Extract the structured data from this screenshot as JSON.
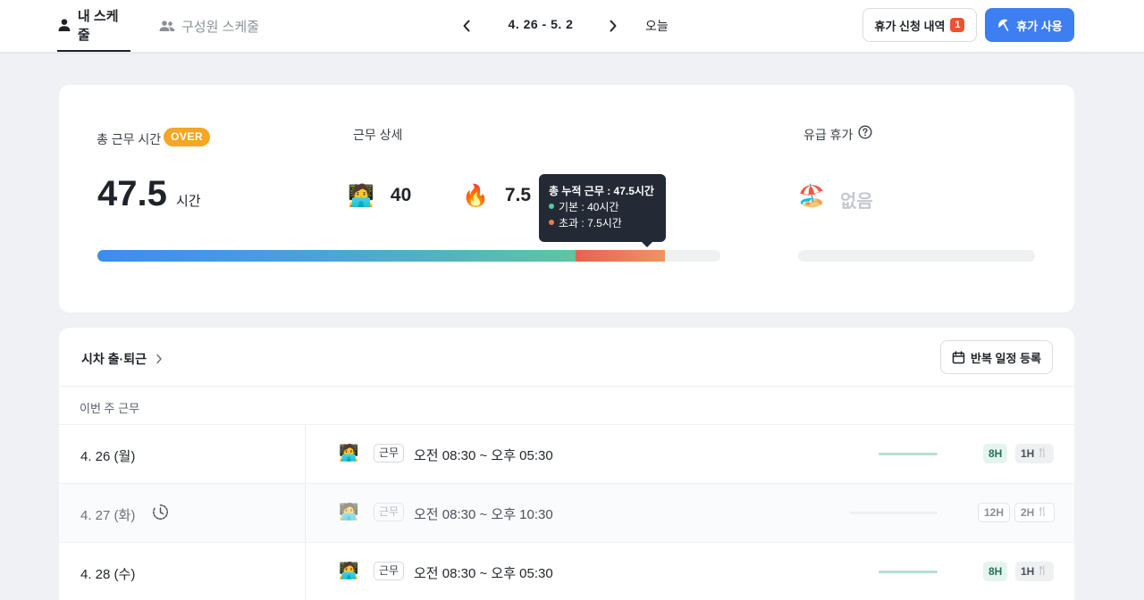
{
  "header": {
    "tab_my": "내 스케줄",
    "tab_members": "구성원 스케줄",
    "date_range": "4. 26 - 5. 2",
    "today": "오늘",
    "history_label": "휴가 신청 내역",
    "history_count": "1",
    "leave_use_label": "휴가 사용",
    "accent_color": "#3d7ff0"
  },
  "summary": {
    "total_label": "총 근무 시간",
    "over_badge": "OVER",
    "total_value": "47.5",
    "total_unit": "시간",
    "detail_label": "근무 상세",
    "base_emoji": "🧑‍💻",
    "base_value": "40",
    "over_emoji": "🔥",
    "over_value": "7.5",
    "tooltip": {
      "title": "총 누적 근무 : 47.5시간",
      "base": "기본 : 40시간",
      "over": "초과 : 7.5시간",
      "base_color": "#5cc6a0",
      "over_color": "#ee7a4f"
    },
    "progress": {
      "base_fraction": 0.768,
      "over_fraction": 0.144
    },
    "paid_leave_label": "유급 휴가",
    "paid_leave_emoji": "🏖️",
    "paid_leave_value": "없음"
  },
  "schedule": {
    "flex_link": "시차 출·퇴근",
    "repeat_button": "반복 일정 등록",
    "week_label": "이번 주 근무",
    "rows": [
      {
        "date": "4. 26 (월)",
        "chip": "근무",
        "time": "오전 08:30 ~ 오후 05:30",
        "hours": "8H",
        "break": "1H",
        "bar_fraction": 0.25
      },
      {
        "date": "4. 27 (화)",
        "chip": "근무",
        "time": "오전 08:30 ~ 오후 10:30",
        "hours": "12H",
        "break": "2H",
        "bar_fraction": 0.37
      },
      {
        "date": "4. 28 (수)",
        "chip": "근무",
        "time": "오전 08:30 ~ 오후 05:30",
        "hours": "8H",
        "break": "1H",
        "bar_fraction": 0.25
      }
    ],
    "avatar_emoji": "🧑‍💻",
    "break_icon": "🍴"
  }
}
